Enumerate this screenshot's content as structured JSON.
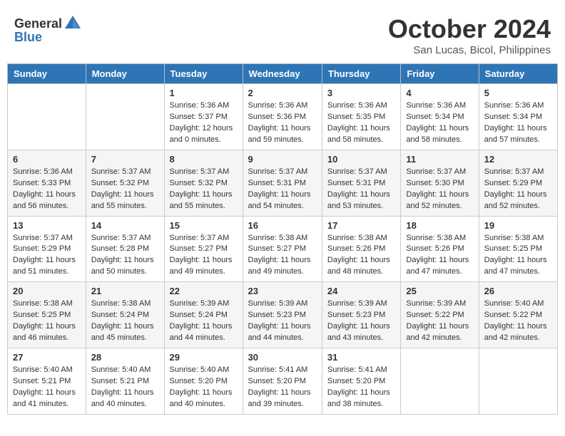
{
  "header": {
    "logo_general": "General",
    "logo_blue": "Blue",
    "month": "October 2024",
    "location": "San Lucas, Bicol, Philippines"
  },
  "weekdays": [
    "Sunday",
    "Monday",
    "Tuesday",
    "Wednesday",
    "Thursday",
    "Friday",
    "Saturday"
  ],
  "weeks": [
    [
      {
        "day": "",
        "info": ""
      },
      {
        "day": "",
        "info": ""
      },
      {
        "day": "1",
        "info": "Sunrise: 5:36 AM\nSunset: 5:37 PM\nDaylight: 12 hours\nand 0 minutes."
      },
      {
        "day": "2",
        "info": "Sunrise: 5:36 AM\nSunset: 5:36 PM\nDaylight: 11 hours\nand 59 minutes."
      },
      {
        "day": "3",
        "info": "Sunrise: 5:36 AM\nSunset: 5:35 PM\nDaylight: 11 hours\nand 58 minutes."
      },
      {
        "day": "4",
        "info": "Sunrise: 5:36 AM\nSunset: 5:34 PM\nDaylight: 11 hours\nand 58 minutes."
      },
      {
        "day": "5",
        "info": "Sunrise: 5:36 AM\nSunset: 5:34 PM\nDaylight: 11 hours\nand 57 minutes."
      }
    ],
    [
      {
        "day": "6",
        "info": "Sunrise: 5:36 AM\nSunset: 5:33 PM\nDaylight: 11 hours\nand 56 minutes."
      },
      {
        "day": "7",
        "info": "Sunrise: 5:37 AM\nSunset: 5:32 PM\nDaylight: 11 hours\nand 55 minutes."
      },
      {
        "day": "8",
        "info": "Sunrise: 5:37 AM\nSunset: 5:32 PM\nDaylight: 11 hours\nand 55 minutes."
      },
      {
        "day": "9",
        "info": "Sunrise: 5:37 AM\nSunset: 5:31 PM\nDaylight: 11 hours\nand 54 minutes."
      },
      {
        "day": "10",
        "info": "Sunrise: 5:37 AM\nSunset: 5:31 PM\nDaylight: 11 hours\nand 53 minutes."
      },
      {
        "day": "11",
        "info": "Sunrise: 5:37 AM\nSunset: 5:30 PM\nDaylight: 11 hours\nand 52 minutes."
      },
      {
        "day": "12",
        "info": "Sunrise: 5:37 AM\nSunset: 5:29 PM\nDaylight: 11 hours\nand 52 minutes."
      }
    ],
    [
      {
        "day": "13",
        "info": "Sunrise: 5:37 AM\nSunset: 5:29 PM\nDaylight: 11 hours\nand 51 minutes."
      },
      {
        "day": "14",
        "info": "Sunrise: 5:37 AM\nSunset: 5:28 PM\nDaylight: 11 hours\nand 50 minutes."
      },
      {
        "day": "15",
        "info": "Sunrise: 5:37 AM\nSunset: 5:27 PM\nDaylight: 11 hours\nand 49 minutes."
      },
      {
        "day": "16",
        "info": "Sunrise: 5:38 AM\nSunset: 5:27 PM\nDaylight: 11 hours\nand 49 minutes."
      },
      {
        "day": "17",
        "info": "Sunrise: 5:38 AM\nSunset: 5:26 PM\nDaylight: 11 hours\nand 48 minutes."
      },
      {
        "day": "18",
        "info": "Sunrise: 5:38 AM\nSunset: 5:26 PM\nDaylight: 11 hours\nand 47 minutes."
      },
      {
        "day": "19",
        "info": "Sunrise: 5:38 AM\nSunset: 5:25 PM\nDaylight: 11 hours\nand 47 minutes."
      }
    ],
    [
      {
        "day": "20",
        "info": "Sunrise: 5:38 AM\nSunset: 5:25 PM\nDaylight: 11 hours\nand 46 minutes."
      },
      {
        "day": "21",
        "info": "Sunrise: 5:38 AM\nSunset: 5:24 PM\nDaylight: 11 hours\nand 45 minutes."
      },
      {
        "day": "22",
        "info": "Sunrise: 5:39 AM\nSunset: 5:24 PM\nDaylight: 11 hours\nand 44 minutes."
      },
      {
        "day": "23",
        "info": "Sunrise: 5:39 AM\nSunset: 5:23 PM\nDaylight: 11 hours\nand 44 minutes."
      },
      {
        "day": "24",
        "info": "Sunrise: 5:39 AM\nSunset: 5:23 PM\nDaylight: 11 hours\nand 43 minutes."
      },
      {
        "day": "25",
        "info": "Sunrise: 5:39 AM\nSunset: 5:22 PM\nDaylight: 11 hours\nand 42 minutes."
      },
      {
        "day": "26",
        "info": "Sunrise: 5:40 AM\nSunset: 5:22 PM\nDaylight: 11 hours\nand 42 minutes."
      }
    ],
    [
      {
        "day": "27",
        "info": "Sunrise: 5:40 AM\nSunset: 5:21 PM\nDaylight: 11 hours\nand 41 minutes."
      },
      {
        "day": "28",
        "info": "Sunrise: 5:40 AM\nSunset: 5:21 PM\nDaylight: 11 hours\nand 40 minutes."
      },
      {
        "day": "29",
        "info": "Sunrise: 5:40 AM\nSunset: 5:20 PM\nDaylight: 11 hours\nand 40 minutes."
      },
      {
        "day": "30",
        "info": "Sunrise: 5:41 AM\nSunset: 5:20 PM\nDaylight: 11 hours\nand 39 minutes."
      },
      {
        "day": "31",
        "info": "Sunrise: 5:41 AM\nSunset: 5:20 PM\nDaylight: 11 hours\nand 38 minutes."
      },
      {
        "day": "",
        "info": ""
      },
      {
        "day": "",
        "info": ""
      }
    ]
  ]
}
